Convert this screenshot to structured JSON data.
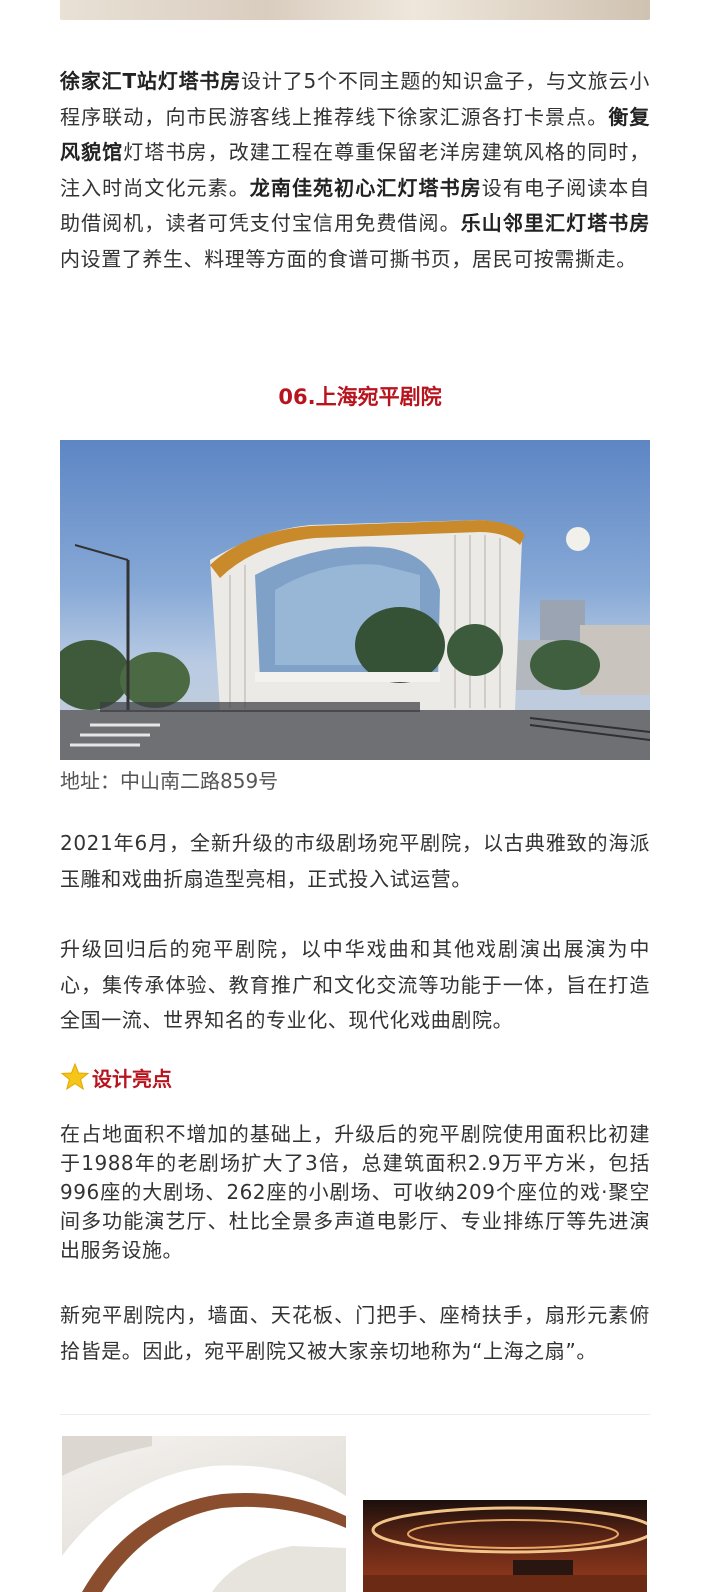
{
  "intro": {
    "segments": [
      {
        "text": "徐家汇T站灯塔书房",
        "bold": true
      },
      {
        "text": "设计了5个不同主题的知识盒子，与文旅云小程序联动，向市民游客线上推荐线下徐家汇源各打卡景点。",
        "bold": false
      },
      {
        "text": "衡复风貌馆",
        "bold": true
      },
      {
        "text": "灯塔书房，改建工程在尊重保留老洋房建筑风格的同时，注入时尚文化元素。",
        "bold": false
      },
      {
        "text": "龙南佳苑初心汇灯塔书房",
        "bold": true
      },
      {
        "text": "设有电子阅读本自助借阅机，读者可凭支付宝信用免费借阅。",
        "bold": false
      },
      {
        "text": "乐山邻里汇灯塔书房",
        "bold": true
      },
      {
        "text": "内设置了养生、料理等方面的食谱可撕书页，居民可按需撕走。",
        "bold": false
      }
    ]
  },
  "section": {
    "title": "06.上海宛平剧院",
    "photo_caption": "地址：中山南二路859号"
  },
  "body": {
    "paragraph_1": "2021年6月，全新升级的市级剧场宛平剧院，以古典雅致的海派玉雕和戏曲折扇造型亮相，正式投入试运营。",
    "paragraph_2": "升级回归后的宛平剧院，以中华戏曲和其他戏剧演出展演为中心，集传承体验、教育推广和文化交流等功能于一体，旨在打造全国一流、世界知名的专业化、现代化戏曲剧院。",
    "subheading": "设计亮点",
    "paragraph_3": "在占地面积不增加的基础上，升级后的宛平剧院使用面积比初建于1988年的老剧场扩大了3倍，总建筑面积2.9万平方米，包括996座的大剧场、262座的小剧场、可收纳209个座位的戏·聚空间多功能演艺厅、杜比全景多声道电影厅、专业排练厅等先进演出服务设施。",
    "paragraph_4": "新宛平剧院内，墙面、天花板、门把手、座椅扶手，扇形元素俯拾皆是。因此，宛平剧院又被大家亲切地称为“上海之扇”。"
  },
  "icons": {
    "subheading_icon": "star-icon"
  },
  "colors": {
    "accent_red": "#b8141e",
    "body_text": "#333333",
    "caption_text": "#555555",
    "star": "#f5c518"
  }
}
